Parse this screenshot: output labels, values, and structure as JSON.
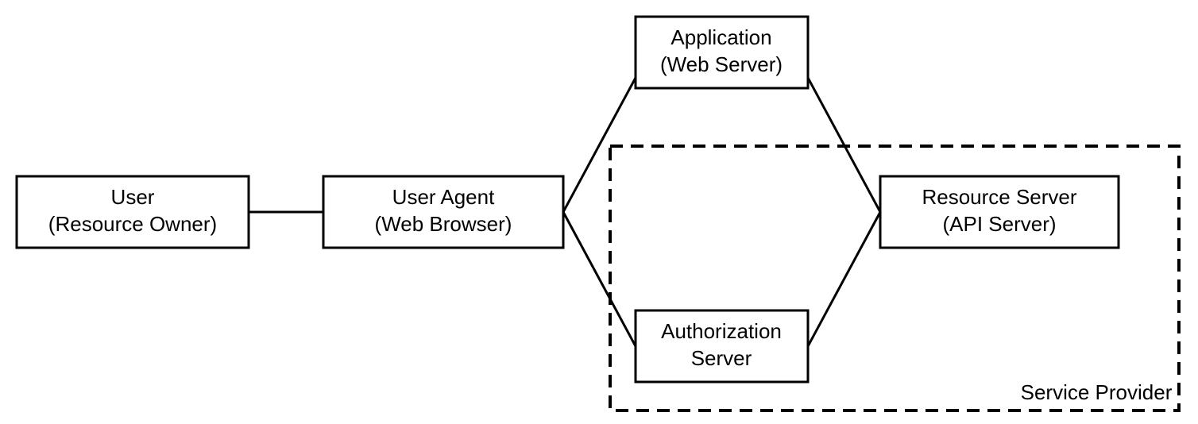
{
  "nodes": {
    "user": {
      "line1": "User",
      "line2": "(Resource Owner)"
    },
    "agent": {
      "line1": "User Agent",
      "line2": "(Web Browser)"
    },
    "app": {
      "line1": "Application",
      "line2": "(Web Server)"
    },
    "auth": {
      "line1": "Authorization",
      "line2": "Server"
    },
    "resource": {
      "line1": "Resource Server",
      "line2": "(API Server)"
    }
  },
  "group_label": "Service Provider"
}
